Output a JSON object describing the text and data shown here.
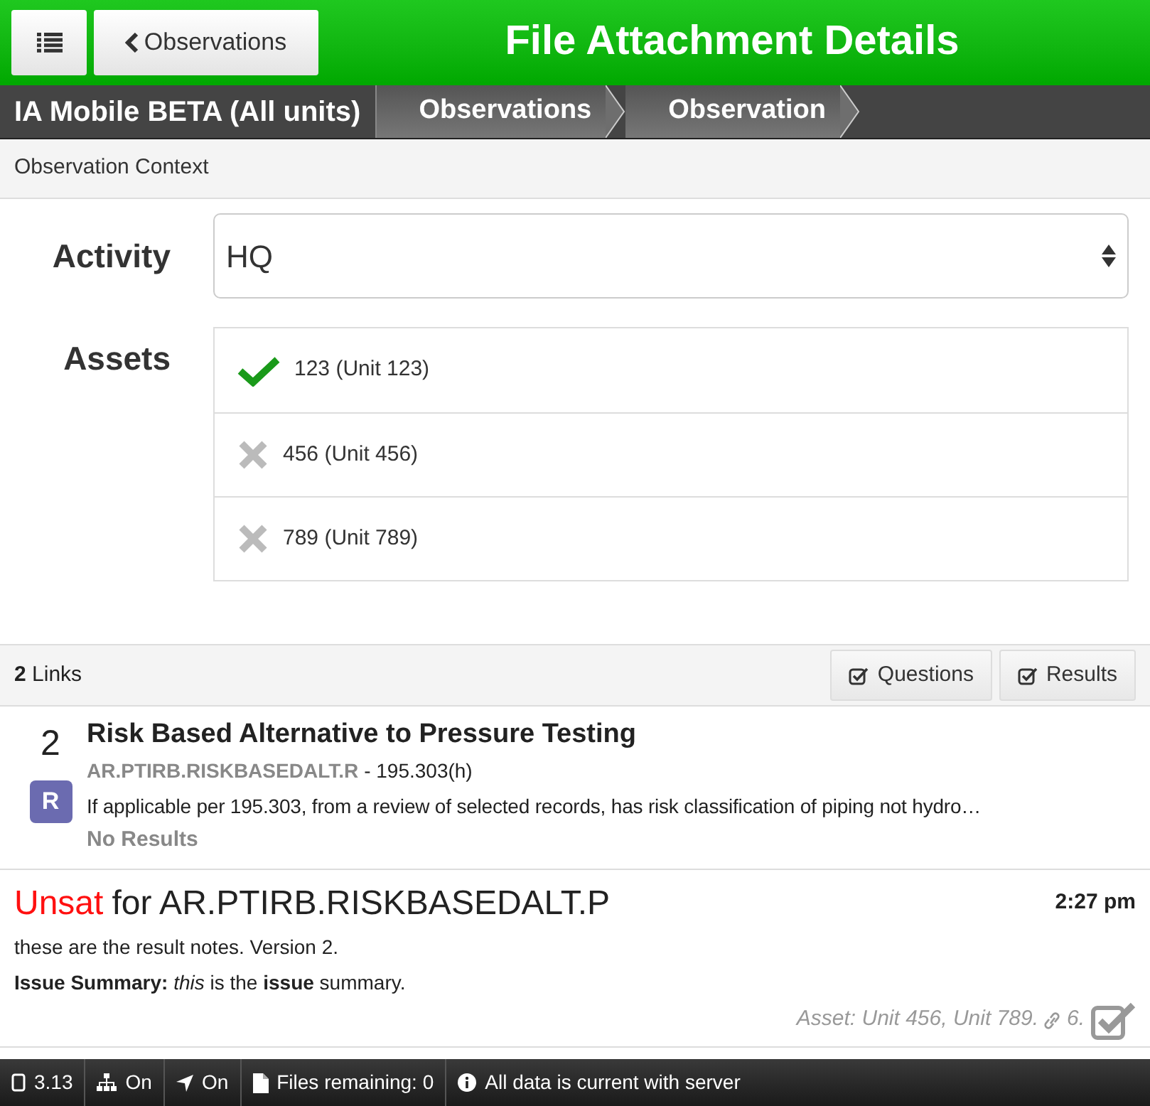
{
  "header": {
    "back_button": "Observations",
    "title": "File Attachment Details"
  },
  "breadcrumbs": {
    "app": "IA Mobile BETA (All units)",
    "items": [
      "Observations",
      "Observation"
    ]
  },
  "section_title": "Observation Context",
  "activity": {
    "label": "Activity",
    "value": "HQ"
  },
  "assets": {
    "label": "Assets",
    "items": [
      {
        "label": "123 (Unit 123)",
        "checked": true
      },
      {
        "label": "456 (Unit 456)",
        "checked": false
      },
      {
        "label": "789 (Unit 789)",
        "checked": false
      }
    ]
  },
  "links": {
    "count": "2",
    "label": "Links",
    "buttons": [
      "Questions",
      "Results"
    ]
  },
  "question": {
    "number": "2",
    "badge": "R",
    "title": "Risk Based Alternative to Pressure Testing",
    "code": "AR.PTIRB.RISKBASEDALT.R",
    "reference": "- 195.303(h)",
    "text": "If applicable per 195.303, from a review of selected records, has risk classification of piping not hydro…",
    "status": "No Results"
  },
  "result": {
    "outcome": "Unsat",
    "heading": "for AR.PTIRB.RISKBASEDALT.P",
    "time": "2:27 pm",
    "notes": "these are the result notes. Version 2.",
    "summary": "**Issue Summary:** *this* is the **issue** summary.",
    "assets": "Asset: Unit 456, Unit 789.",
    "attachments": "6.",
    "checked": true
  },
  "status_bar": [
    {
      "kind": "device",
      "text": "3.13"
    },
    {
      "kind": "network",
      "text": "On"
    },
    {
      "kind": "location",
      "text": "On"
    },
    {
      "kind": "file",
      "text": "Files remaining: 0"
    },
    {
      "kind": "info",
      "text": "All data is current with server"
    }
  ]
}
